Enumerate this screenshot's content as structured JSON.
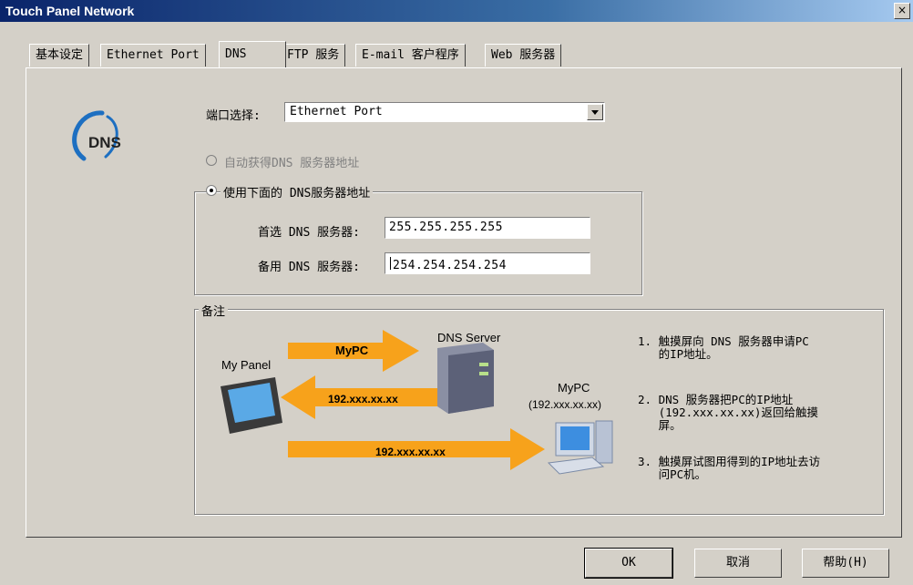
{
  "window": {
    "title": "Touch Panel Network",
    "close_glyph": "×"
  },
  "tabs": [
    "基本设定",
    "Ethernet Port",
    "DNS",
    "FTP 服务",
    "E-mail 客户程序",
    "Web 服务器"
  ],
  "logo": {
    "text": "DNS"
  },
  "port": {
    "label": "端口选择:",
    "value": "Ethernet Port"
  },
  "radio_auto": {
    "label": "自动获得DNS 服务器地址",
    "checked": false,
    "enabled": false
  },
  "radio_manual": {
    "label": "使用下面的 DNS服务器地址",
    "checked": true
  },
  "preferred_dns": {
    "label": "首选 DNS 服务器:",
    "value": "255.255.255.255"
  },
  "alternate_dns": {
    "label": "备用 DNS 服务器:",
    "value": "254.254.254.254"
  },
  "notes": {
    "legend": "备注",
    "diagram": {
      "my_panel": "My Panel",
      "dns_server": "DNS Server",
      "mypc": "MyPC",
      "mypc_ip": "(192.xxx.xx.xx)",
      "arrow1": "MyPC",
      "arrow2": "192.xxx.xx.xx",
      "arrow3": "192.xxx.xx.xx"
    },
    "steps": [
      "1. 触摸屏向 DNS 服务器申请PC\n   的IP地址。",
      "2. DNS 服务器把PC的IP地址\n   (192.xxx.xx.xx)返回给触摸\n   屏。",
      "3. 触摸屏试图用得到的IP地址去访\n   问PC机。"
    ]
  },
  "buttons": {
    "ok": "OK",
    "cancel": "取消",
    "help": "帮助(H)"
  },
  "colors": {
    "arrow": "#f7a21b",
    "title_bar": "#0a246a",
    "dialog": "#d4d0c8"
  }
}
